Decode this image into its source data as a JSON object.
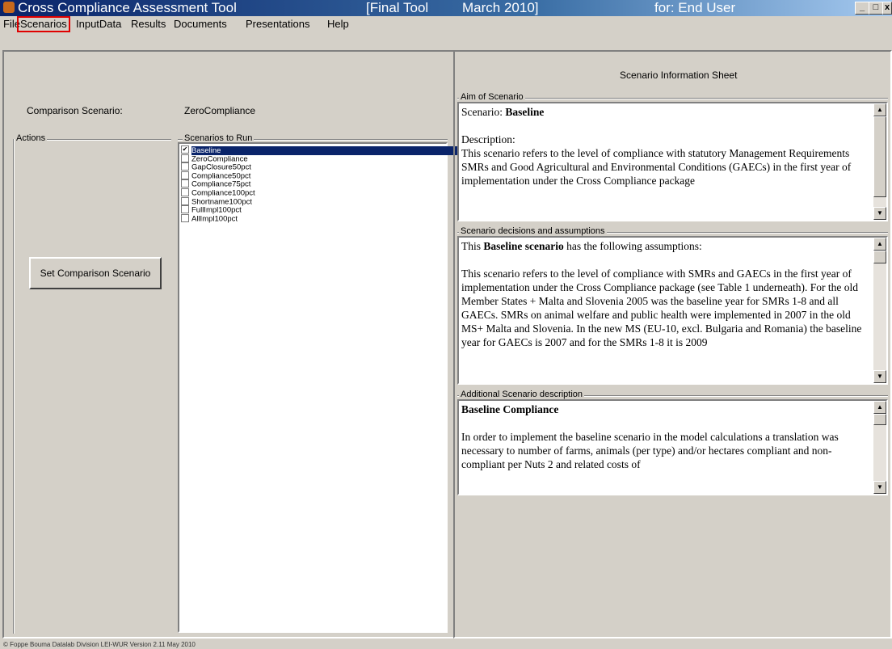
{
  "window": {
    "app_title": "Cross Compliance Assessment Tool",
    "version_tag": "[Final Tool",
    "date_tag": "March 2010]",
    "for_tag": "for:  End User"
  },
  "menu": [
    "File",
    "Scenarios",
    "InputData",
    "Results",
    "Documents",
    "Presentations",
    "Help"
  ],
  "left": {
    "comparison_label": "Comparison Scenario:",
    "comparison_value": "ZeroCompliance",
    "actions_label": "Actions",
    "scenarios_label": "Scenarios to Run",
    "set_button": "Set  Comparison Scenario",
    "scenarios": [
      {
        "label": "Baseline",
        "checked": true
      },
      {
        "label": "ZeroCompliance",
        "checked": false
      },
      {
        "label": "GapClosure50pct",
        "checked": false
      },
      {
        "label": "Compliance50pct",
        "checked": false
      },
      {
        "label": "Compliance75pct",
        "checked": false
      },
      {
        "label": "Compliance100pct",
        "checked": false
      },
      {
        "label": "Shortname100pct",
        "checked": false
      },
      {
        "label": "FullImpl100pct",
        "checked": false
      },
      {
        "label": "AllImpl100pct",
        "checked": false
      }
    ]
  },
  "right": {
    "sheet_title": "Scenario Information Sheet",
    "aim_label": "Aim of Scenario",
    "aim_scenario_prefix": "Scenario:  ",
    "aim_scenario_name": "Baseline",
    "aim_desc_label": "Description:",
    "aim_desc_text": "This scenario refers to the level of compliance with statutory Management Requirements SMRs and Good Agricultural and Environmental Conditions (GAECs) in the first year of implementation under the Cross Compliance package",
    "decisions_label": "Scenario decisions and assumptions",
    "decisions_intro_pre": "This ",
    "decisions_intro_bold": "Baseline scenario",
    "decisions_intro_post": " has the following assumptions:",
    "decisions_text": "This scenario refers to the level of compliance with SMRs and GAECs in the first year of implementation under the Cross Compliance package (see Table 1 underneath). For the old Member States + Malta and Slovenia 2005 was the baseline year for SMRs 1-8 and all GAECs. SMRs on animal welfare and public health were implemented in 2007 in the old MS+ Malta and Slovenia. In the new MS (EU-10, excl. Bulgaria and Romania) the baseline year for GAECs is 2007 and for the SMRs 1-8 it is 2009",
    "additional_label": "Additional Scenario description",
    "additional_title": "Baseline Compliance",
    "additional_text": "In order to implement the baseline scenario in the model calculations a translation was necessary to number of farms, animals (per type) and/or hectares compliant and non-compliant per Nuts 2 and related costs of"
  },
  "status": "© Foppe Bouma    Datalab Division LEI-WUR   Version  2.11 May 2010"
}
